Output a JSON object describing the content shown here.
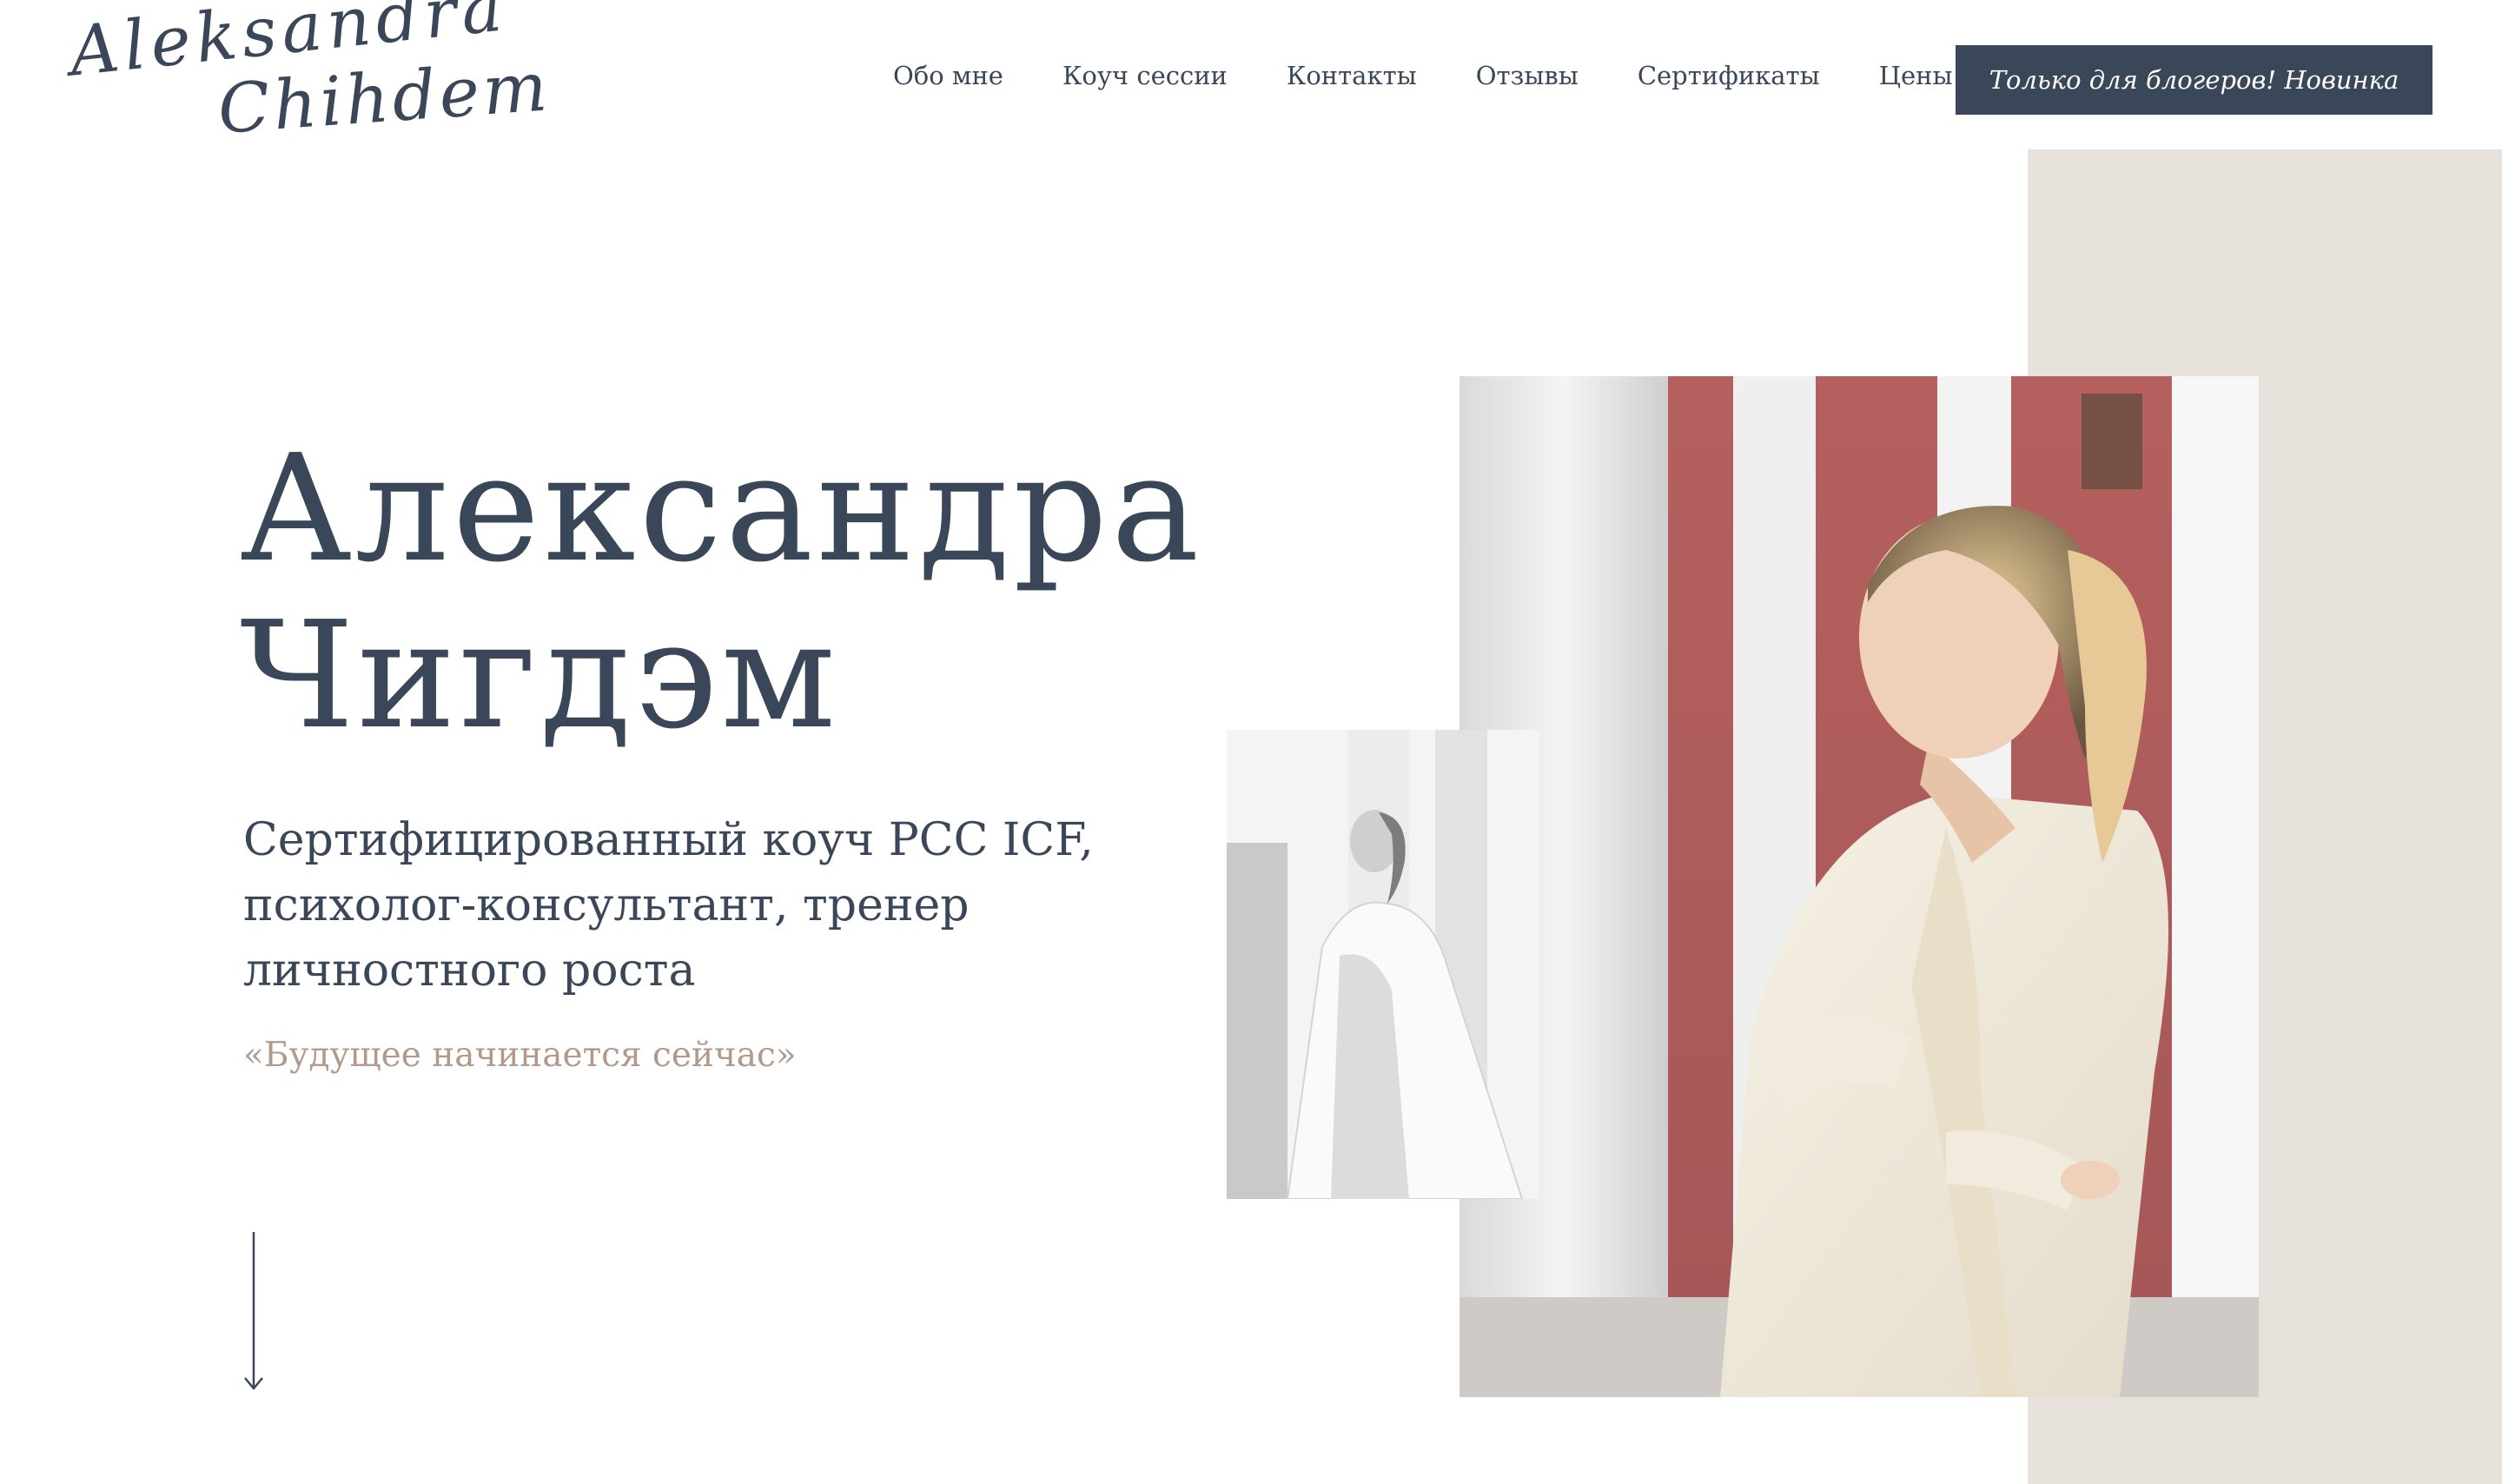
{
  "logo": {
    "line1": "Aleksandra",
    "line2": "Chihdem"
  },
  "nav": {
    "items": [
      {
        "label": "Обо мне"
      },
      {
        "label": "Коуч сессии"
      },
      {
        "label": "Контакты"
      },
      {
        "label": "Отзывы"
      },
      {
        "label": "Сертификаты"
      },
      {
        "label": "Цены"
      }
    ],
    "cta_label": "Только для блогеров! Новинка"
  },
  "hero": {
    "title_line1": "Александра",
    "title_line2": "Чигдэм",
    "subtitle_line1": "Сертифицированный коуч PCC ICF,",
    "subtitle_line2": "психолог-консультант, тренер",
    "subtitle_line3": "личностного роста",
    "quote": "«Будущее начинается сейчас»"
  },
  "icons": {
    "scroll": "arrow-down-icon"
  },
  "colors": {
    "primary": "#3a4759",
    "accent_quote": "#b3998a",
    "side_panel": "#e7e2dc",
    "background": "#ffffff"
  }
}
